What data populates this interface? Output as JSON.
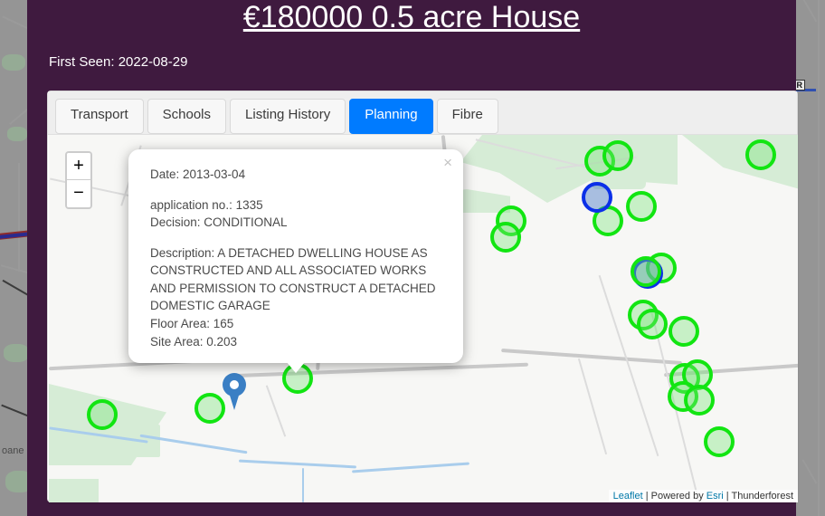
{
  "page": {
    "title": "€180000 0.5 acre House",
    "first_seen": "First Seen: 2022-08-29",
    "background_color": "#3f1a3f"
  },
  "tabs": [
    {
      "label": "Transport",
      "active": false
    },
    {
      "label": "Schools",
      "active": false
    },
    {
      "label": "Listing History",
      "active": false
    },
    {
      "label": "Planning",
      "active": true
    },
    {
      "label": "Fibre",
      "active": false
    }
  ],
  "map": {
    "zoom_in_label": "+",
    "zoom_out_label": "−",
    "attribution": {
      "leaflet": "Leaflet",
      "sep1": " | ",
      "powered_by": "Powered by ",
      "esri": "Esri",
      "sep2": " | ",
      "thunderforest": "Thunderforest"
    },
    "marker_colors": {
      "planning_green": "#12e512",
      "planning_selected_blue": "#0b30e8",
      "property_pin_blue": "#3a7fc4"
    }
  },
  "popup": {
    "close_label": "×",
    "date": "Date: 2013-03-04",
    "application_no": "application no.: 1335",
    "decision": "Decision: CONDITIONAL",
    "description": "Description: A DETACHED DWELLING HOUSE AS CONSTRUCTED AND ALL ASSOCIATED WORKS AND PERMISSION TO CONSTRUCT A DETACHED DOMESTIC GARAGE",
    "floor_area": "Floor Area: 165",
    "site_area": "Site Area: 0.203"
  },
  "background_map": {
    "place_label": "oane",
    "road_shield": "R"
  }
}
